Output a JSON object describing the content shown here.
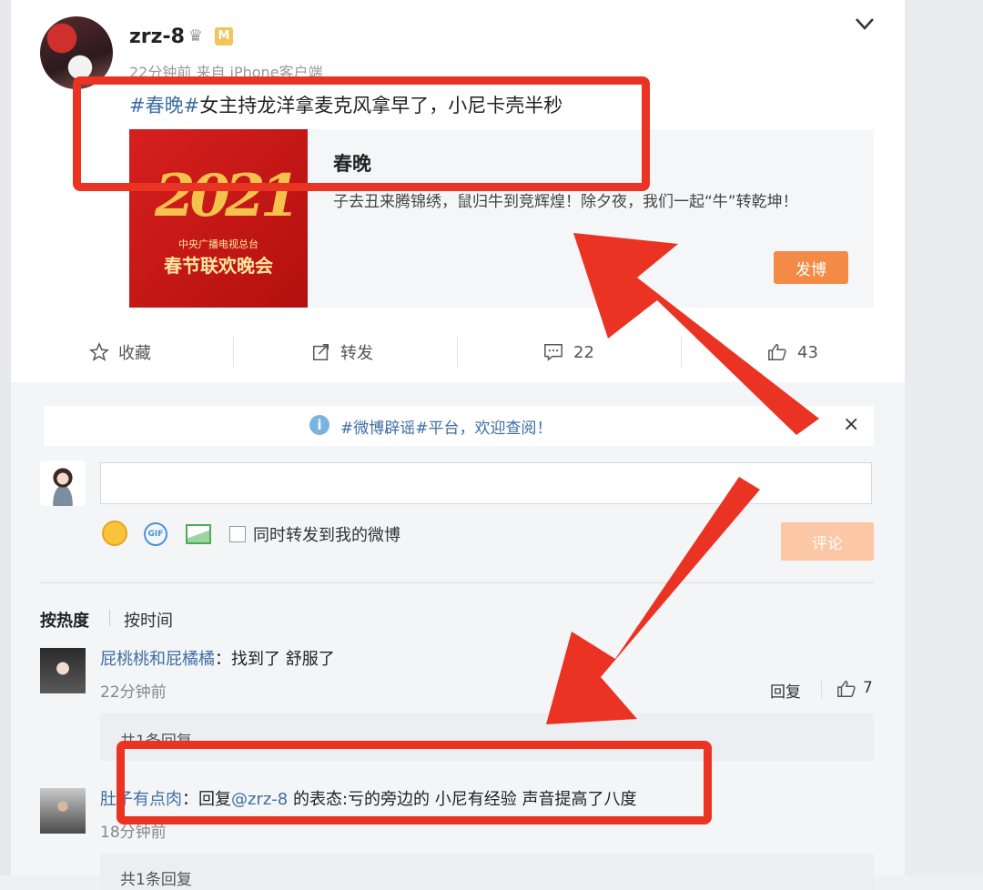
{
  "post": {
    "username": "zrz-8",
    "badge": "M",
    "meta": "22分钟前 来自 iPhone客户端",
    "hashtag": "#春晚#",
    "text": "女主持龙洋拿麦克风拿早了，小尼卡壳半秒"
  },
  "topic_card": {
    "thumb_number": "2021",
    "thumb_line1": "中央广播电视总台",
    "thumb_line2": "春节联欢晚会",
    "title": "春晚",
    "description": "子去丑来腾锦绣，鼠归牛到竞辉煌！除夕夜，我们一起“牛”转乾坤！",
    "post_button": "发博"
  },
  "actions": {
    "favorite": "收藏",
    "repost": "转发",
    "comment_count": "22",
    "like_count": "43"
  },
  "notice": {
    "text": "#微博辟谣#平台，欢迎查阅！",
    "close": "×"
  },
  "composer": {
    "placeholder": "",
    "gif_label": "GIF",
    "repost_label": "同时转发到我的微博",
    "submit": "评论"
  },
  "sort": {
    "hot": "按热度",
    "time": "按时间"
  },
  "comments": [
    {
      "user": "屁桃桃和屁橘橘",
      "text": "：找到了 舒服了",
      "time": "22分钟前",
      "reply_label": "回复",
      "likes": "7",
      "reply_count": "共1条回复"
    },
    {
      "user": "肚子有点肉",
      "text": "：回复",
      "mention": "@zrz-8",
      "text2": " 的表态:亏的旁边的 小尼有经验 声音提高了八度",
      "time": "18分钟前",
      "reply_count": "共1条回复"
    }
  ],
  "colors": {
    "link_blue": "#3d6ea5",
    "accent_orange": "#f38a45",
    "highlight_red": "#ea3323"
  }
}
